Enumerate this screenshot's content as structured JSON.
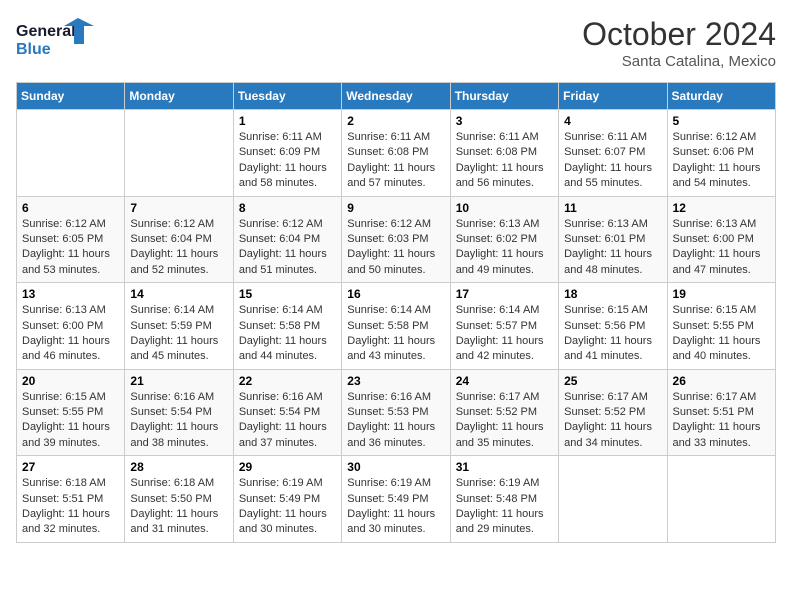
{
  "logo": {
    "line1": "General",
    "line2": "Blue"
  },
  "title": "October 2024",
  "location": "Santa Catalina, Mexico",
  "days_of_week": [
    "Sunday",
    "Monday",
    "Tuesday",
    "Wednesday",
    "Thursday",
    "Friday",
    "Saturday"
  ],
  "weeks": [
    [
      {
        "day": "",
        "sunrise": "",
        "sunset": "",
        "daylight": ""
      },
      {
        "day": "",
        "sunrise": "",
        "sunset": "",
        "daylight": ""
      },
      {
        "day": "1",
        "sunrise": "Sunrise: 6:11 AM",
        "sunset": "Sunset: 6:09 PM",
        "daylight": "Daylight: 11 hours and 58 minutes."
      },
      {
        "day": "2",
        "sunrise": "Sunrise: 6:11 AM",
        "sunset": "Sunset: 6:08 PM",
        "daylight": "Daylight: 11 hours and 57 minutes."
      },
      {
        "day": "3",
        "sunrise": "Sunrise: 6:11 AM",
        "sunset": "Sunset: 6:08 PM",
        "daylight": "Daylight: 11 hours and 56 minutes."
      },
      {
        "day": "4",
        "sunrise": "Sunrise: 6:11 AM",
        "sunset": "Sunset: 6:07 PM",
        "daylight": "Daylight: 11 hours and 55 minutes."
      },
      {
        "day": "5",
        "sunrise": "Sunrise: 6:12 AM",
        "sunset": "Sunset: 6:06 PM",
        "daylight": "Daylight: 11 hours and 54 minutes."
      }
    ],
    [
      {
        "day": "6",
        "sunrise": "Sunrise: 6:12 AM",
        "sunset": "Sunset: 6:05 PM",
        "daylight": "Daylight: 11 hours and 53 minutes."
      },
      {
        "day": "7",
        "sunrise": "Sunrise: 6:12 AM",
        "sunset": "Sunset: 6:04 PM",
        "daylight": "Daylight: 11 hours and 52 minutes."
      },
      {
        "day": "8",
        "sunrise": "Sunrise: 6:12 AM",
        "sunset": "Sunset: 6:04 PM",
        "daylight": "Daylight: 11 hours and 51 minutes."
      },
      {
        "day": "9",
        "sunrise": "Sunrise: 6:12 AM",
        "sunset": "Sunset: 6:03 PM",
        "daylight": "Daylight: 11 hours and 50 minutes."
      },
      {
        "day": "10",
        "sunrise": "Sunrise: 6:13 AM",
        "sunset": "Sunset: 6:02 PM",
        "daylight": "Daylight: 11 hours and 49 minutes."
      },
      {
        "day": "11",
        "sunrise": "Sunrise: 6:13 AM",
        "sunset": "Sunset: 6:01 PM",
        "daylight": "Daylight: 11 hours and 48 minutes."
      },
      {
        "day": "12",
        "sunrise": "Sunrise: 6:13 AM",
        "sunset": "Sunset: 6:00 PM",
        "daylight": "Daylight: 11 hours and 47 minutes."
      }
    ],
    [
      {
        "day": "13",
        "sunrise": "Sunrise: 6:13 AM",
        "sunset": "Sunset: 6:00 PM",
        "daylight": "Daylight: 11 hours and 46 minutes."
      },
      {
        "day": "14",
        "sunrise": "Sunrise: 6:14 AM",
        "sunset": "Sunset: 5:59 PM",
        "daylight": "Daylight: 11 hours and 45 minutes."
      },
      {
        "day": "15",
        "sunrise": "Sunrise: 6:14 AM",
        "sunset": "Sunset: 5:58 PM",
        "daylight": "Daylight: 11 hours and 44 minutes."
      },
      {
        "day": "16",
        "sunrise": "Sunrise: 6:14 AM",
        "sunset": "Sunset: 5:58 PM",
        "daylight": "Daylight: 11 hours and 43 minutes."
      },
      {
        "day": "17",
        "sunrise": "Sunrise: 6:14 AM",
        "sunset": "Sunset: 5:57 PM",
        "daylight": "Daylight: 11 hours and 42 minutes."
      },
      {
        "day": "18",
        "sunrise": "Sunrise: 6:15 AM",
        "sunset": "Sunset: 5:56 PM",
        "daylight": "Daylight: 11 hours and 41 minutes."
      },
      {
        "day": "19",
        "sunrise": "Sunrise: 6:15 AM",
        "sunset": "Sunset: 5:55 PM",
        "daylight": "Daylight: 11 hours and 40 minutes."
      }
    ],
    [
      {
        "day": "20",
        "sunrise": "Sunrise: 6:15 AM",
        "sunset": "Sunset: 5:55 PM",
        "daylight": "Daylight: 11 hours and 39 minutes."
      },
      {
        "day": "21",
        "sunrise": "Sunrise: 6:16 AM",
        "sunset": "Sunset: 5:54 PM",
        "daylight": "Daylight: 11 hours and 38 minutes."
      },
      {
        "day": "22",
        "sunrise": "Sunrise: 6:16 AM",
        "sunset": "Sunset: 5:54 PM",
        "daylight": "Daylight: 11 hours and 37 minutes."
      },
      {
        "day": "23",
        "sunrise": "Sunrise: 6:16 AM",
        "sunset": "Sunset: 5:53 PM",
        "daylight": "Daylight: 11 hours and 36 minutes."
      },
      {
        "day": "24",
        "sunrise": "Sunrise: 6:17 AM",
        "sunset": "Sunset: 5:52 PM",
        "daylight": "Daylight: 11 hours and 35 minutes."
      },
      {
        "day": "25",
        "sunrise": "Sunrise: 6:17 AM",
        "sunset": "Sunset: 5:52 PM",
        "daylight": "Daylight: 11 hours and 34 minutes."
      },
      {
        "day": "26",
        "sunrise": "Sunrise: 6:17 AM",
        "sunset": "Sunset: 5:51 PM",
        "daylight": "Daylight: 11 hours and 33 minutes."
      }
    ],
    [
      {
        "day": "27",
        "sunrise": "Sunrise: 6:18 AM",
        "sunset": "Sunset: 5:51 PM",
        "daylight": "Daylight: 11 hours and 32 minutes."
      },
      {
        "day": "28",
        "sunrise": "Sunrise: 6:18 AM",
        "sunset": "Sunset: 5:50 PM",
        "daylight": "Daylight: 11 hours and 31 minutes."
      },
      {
        "day": "29",
        "sunrise": "Sunrise: 6:19 AM",
        "sunset": "Sunset: 5:49 PM",
        "daylight": "Daylight: 11 hours and 30 minutes."
      },
      {
        "day": "30",
        "sunrise": "Sunrise: 6:19 AM",
        "sunset": "Sunset: 5:49 PM",
        "daylight": "Daylight: 11 hours and 30 minutes."
      },
      {
        "day": "31",
        "sunrise": "Sunrise: 6:19 AM",
        "sunset": "Sunset: 5:48 PM",
        "daylight": "Daylight: 11 hours and 29 minutes."
      },
      {
        "day": "",
        "sunrise": "",
        "sunset": "",
        "daylight": ""
      },
      {
        "day": "",
        "sunrise": "",
        "sunset": "",
        "daylight": ""
      }
    ]
  ]
}
